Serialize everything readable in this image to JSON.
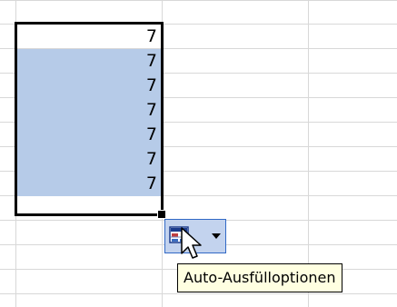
{
  "cells": {
    "values": [
      "7",
      "7",
      "7",
      "7",
      "7",
      "7",
      "7"
    ]
  },
  "autofill": {
    "icon": "autofill-options-icon",
    "arrow_icon": "dropdown-arrow-icon",
    "tooltip": "Auto-Ausfülloptionen"
  },
  "colors": {
    "selection_fill": "#b6cbe8",
    "gridline": "#d8d8d8",
    "button_bg": "#c3d3ee",
    "button_border": "#3169c6",
    "tooltip_bg": "#ffffe1"
  }
}
